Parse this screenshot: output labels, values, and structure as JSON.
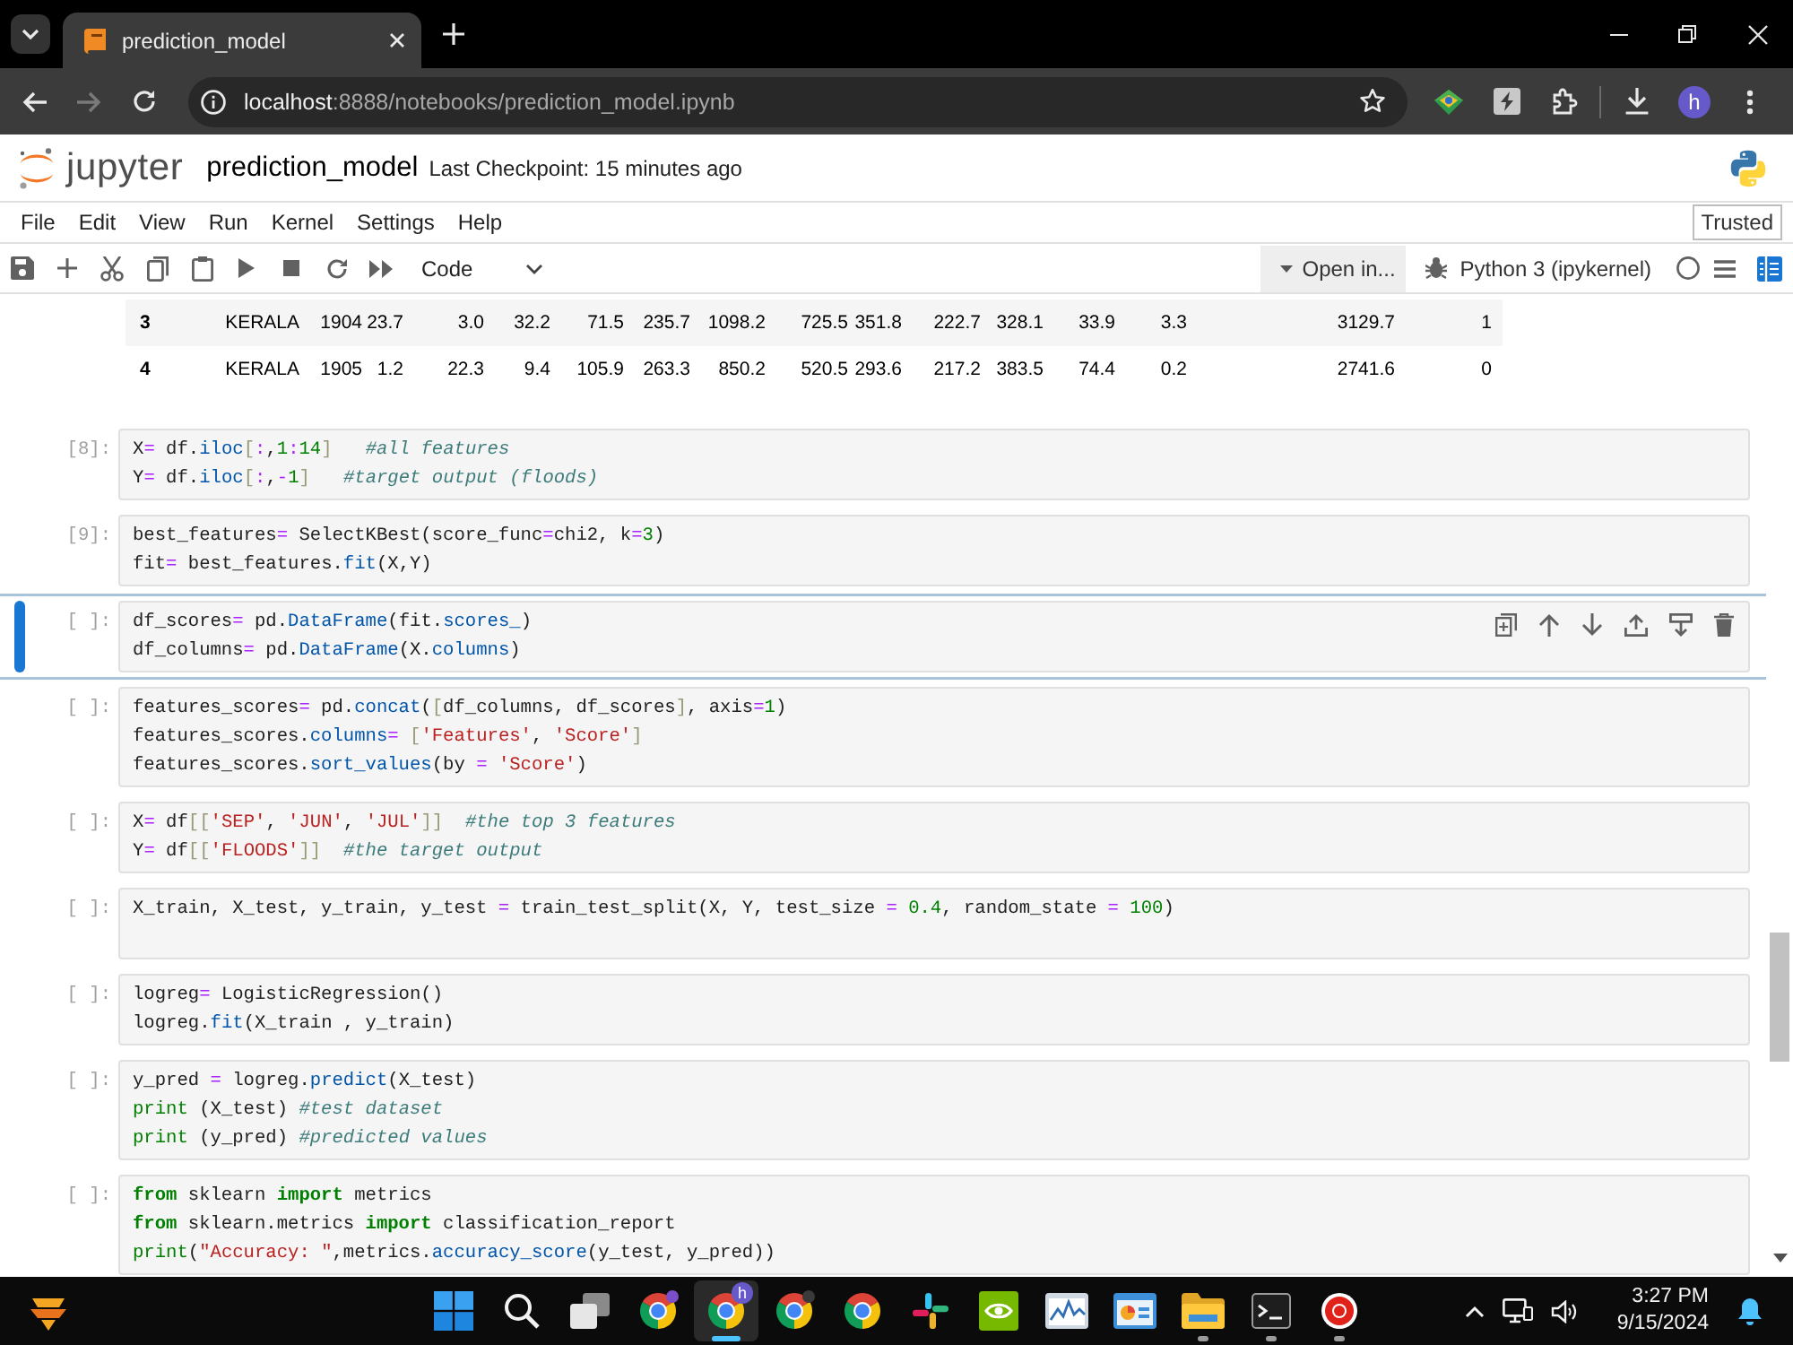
{
  "browser": {
    "tabs": [
      {
        "title": "prediction_model",
        "selected": true
      }
    ],
    "nav": {
      "back_disabled": false,
      "forward_disabled": true
    },
    "address": {
      "host": "localhost",
      "path": ":8888/notebooks/prediction_model.ipynb"
    },
    "profile_initial": "h"
  },
  "notebook_header": {
    "logo_text": "jupyter",
    "title": "prediction_model",
    "checkpoint": "Last Checkpoint: 15 minutes ago"
  },
  "menu": [
    "File",
    "Edit",
    "View",
    "Run",
    "Kernel",
    "Settings",
    "Help"
  ],
  "trust_status": "Trusted",
  "toolbar": {
    "cell_type": "Code",
    "open_in": "Open in...",
    "kernel": "Python 3 (ipykernel)",
    "kernel_busy": false
  },
  "output_table": {
    "rows": [
      [
        "3",
        "KERALA",
        "1904",
        "23.7",
        "3.0",
        "32.2",
        "71.5",
        "235.7",
        "1098.2",
        "725.5",
        "351.8",
        "222.7",
        "328.1",
        "33.9",
        "3.3",
        "3129.7",
        "1"
      ],
      [
        "4",
        "KERALA",
        "1905",
        "1.2",
        "22.3",
        "9.4",
        "105.9",
        "263.3",
        "850.2",
        "520.5",
        "293.6",
        "217.2",
        "383.5",
        "74.4",
        "0.2",
        "2741.6",
        "0"
      ]
    ]
  },
  "cells": [
    {
      "prompt": "[8]:",
      "selected": false,
      "lines": [
        [
          {
            "kind": "plain",
            "text": "X"
          },
          {
            "kind": "op",
            "text": "="
          },
          {
            "kind": "plain",
            "text": " df."
          },
          {
            "kind": "attr",
            "text": "iloc"
          },
          {
            "kind": "bracket",
            "text": "["
          },
          {
            "kind": "op",
            "text": ":"
          },
          {
            "kind": "plain",
            "text": ","
          },
          {
            "kind": "num",
            "text": "1"
          },
          {
            "kind": "op",
            "text": ":"
          },
          {
            "kind": "num",
            "text": "14"
          },
          {
            "kind": "bracket",
            "text": "]   "
          },
          {
            "kind": "comment",
            "text": "#all features"
          }
        ],
        [
          {
            "kind": "plain",
            "text": "Y"
          },
          {
            "kind": "op",
            "text": "="
          },
          {
            "kind": "plain",
            "text": " df."
          },
          {
            "kind": "attr",
            "text": "iloc"
          },
          {
            "kind": "bracket",
            "text": "["
          },
          {
            "kind": "op",
            "text": ":"
          },
          {
            "kind": "plain",
            "text": ","
          },
          {
            "kind": "op",
            "text": "-"
          },
          {
            "kind": "num",
            "text": "1"
          },
          {
            "kind": "bracket",
            "text": "]   "
          },
          {
            "kind": "comment",
            "text": "#target output (floods)"
          }
        ]
      ]
    },
    {
      "prompt": "[9]:",
      "selected": false,
      "lines": [
        [
          {
            "kind": "plain",
            "text": "best_features"
          },
          {
            "kind": "op",
            "text": "="
          },
          {
            "kind": "plain",
            "text": " SelectKBest(score_func"
          },
          {
            "kind": "op",
            "text": "="
          },
          {
            "kind": "plain",
            "text": "chi2, k"
          },
          {
            "kind": "op",
            "text": "="
          },
          {
            "kind": "num",
            "text": "3"
          },
          {
            "kind": "plain",
            "text": ")"
          }
        ],
        [
          {
            "kind": "plain",
            "text": "fit"
          },
          {
            "kind": "op",
            "text": "="
          },
          {
            "kind": "plain",
            "text": " best_features."
          },
          {
            "kind": "attr",
            "text": "fit"
          },
          {
            "kind": "plain",
            "text": "(X,Y)"
          }
        ]
      ]
    },
    {
      "prompt": "[ ]:",
      "selected": true,
      "lines": [
        [
          {
            "kind": "plain",
            "text": "df_scores"
          },
          {
            "kind": "op",
            "text": "="
          },
          {
            "kind": "plain",
            "text": " pd."
          },
          {
            "kind": "attr",
            "text": "DataFrame"
          },
          {
            "kind": "plain",
            "text": "(fit."
          },
          {
            "kind": "attr",
            "text": "scores_"
          },
          {
            "kind": "plain",
            "text": ")"
          }
        ],
        [
          {
            "kind": "plain",
            "text": "df_columns"
          },
          {
            "kind": "op",
            "text": "="
          },
          {
            "kind": "plain",
            "text": " pd."
          },
          {
            "kind": "attr",
            "text": "DataFrame"
          },
          {
            "kind": "plain",
            "text": "(X."
          },
          {
            "kind": "attr",
            "text": "columns"
          },
          {
            "kind": "plain",
            "text": ")"
          }
        ]
      ]
    },
    {
      "prompt": "[ ]:",
      "selected": false,
      "lines": [
        [
          {
            "kind": "plain",
            "text": "features_scores"
          },
          {
            "kind": "op",
            "text": "="
          },
          {
            "kind": "plain",
            "text": " pd."
          },
          {
            "kind": "attr",
            "text": "concat"
          },
          {
            "kind": "plain",
            "text": "("
          },
          {
            "kind": "bracket",
            "text": "["
          },
          {
            "kind": "plain",
            "text": "df_columns, df_scores"
          },
          {
            "kind": "bracket",
            "text": "]"
          },
          {
            "kind": "plain",
            "text": ", axis"
          },
          {
            "kind": "op",
            "text": "="
          },
          {
            "kind": "num",
            "text": "1"
          },
          {
            "kind": "plain",
            "text": ")"
          }
        ],
        [
          {
            "kind": "plain",
            "text": "features_scores."
          },
          {
            "kind": "attr",
            "text": "columns"
          },
          {
            "kind": "op",
            "text": "= "
          },
          {
            "kind": "bracket",
            "text": "["
          },
          {
            "kind": "str",
            "text": "'Features'"
          },
          {
            "kind": "plain",
            "text": ", "
          },
          {
            "kind": "str",
            "text": "'Score'"
          },
          {
            "kind": "bracket",
            "text": "]"
          }
        ],
        [
          {
            "kind": "plain",
            "text": "features_scores."
          },
          {
            "kind": "attr",
            "text": "sort_values"
          },
          {
            "kind": "plain",
            "text": "(by "
          },
          {
            "kind": "op",
            "text": "= "
          },
          {
            "kind": "str",
            "text": "'Score'"
          },
          {
            "kind": "plain",
            "text": ")"
          }
        ]
      ]
    },
    {
      "prompt": "[ ]:",
      "selected": false,
      "lines": [
        [
          {
            "kind": "plain",
            "text": "X"
          },
          {
            "kind": "op",
            "text": "="
          },
          {
            "kind": "plain",
            "text": " df"
          },
          {
            "kind": "bracket",
            "text": "[["
          },
          {
            "kind": "str",
            "text": "'SEP'"
          },
          {
            "kind": "plain",
            "text": ", "
          },
          {
            "kind": "str",
            "text": "'JUN'"
          },
          {
            "kind": "plain",
            "text": ", "
          },
          {
            "kind": "str",
            "text": "'JUL'"
          },
          {
            "kind": "bracket",
            "text": "]]  "
          },
          {
            "kind": "comment",
            "text": "#the top 3 features"
          }
        ],
        [
          {
            "kind": "plain",
            "text": "Y"
          },
          {
            "kind": "op",
            "text": "="
          },
          {
            "kind": "plain",
            "text": " df"
          },
          {
            "kind": "bracket",
            "text": "[["
          },
          {
            "kind": "str",
            "text": "'FLOODS'"
          },
          {
            "kind": "bracket",
            "text": "]]  "
          },
          {
            "kind": "comment",
            "text": "#the target output"
          }
        ]
      ]
    },
    {
      "prompt": "[ ]:",
      "selected": false,
      "lines": [
        [
          {
            "kind": "plain",
            "text": "X_train, X_test, y_train, y_test "
          },
          {
            "kind": "op",
            "text": "="
          },
          {
            "kind": "plain",
            "text": " train_test_split(X, Y, test_size "
          },
          {
            "kind": "op",
            "text": "= "
          },
          {
            "kind": "num",
            "text": "0.4"
          },
          {
            "kind": "plain",
            "text": ", random_state "
          },
          {
            "kind": "op",
            "text": "= "
          },
          {
            "kind": "num",
            "text": "100"
          },
          {
            "kind": "plain",
            "text": ")"
          }
        ]
      ]
    },
    {
      "prompt": "[ ]:",
      "selected": false,
      "lines": [
        [
          {
            "kind": "plain",
            "text": "logreg"
          },
          {
            "kind": "op",
            "text": "="
          },
          {
            "kind": "plain",
            "text": " LogisticRegression()"
          }
        ],
        [
          {
            "kind": "plain",
            "text": "logreg."
          },
          {
            "kind": "attr",
            "text": "fit"
          },
          {
            "kind": "plain",
            "text": "(X_train , y_train)"
          }
        ]
      ]
    },
    {
      "prompt": "[ ]:",
      "selected": false,
      "lines": [
        [
          {
            "kind": "plain",
            "text": "y_pred "
          },
          {
            "kind": "op",
            "text": "="
          },
          {
            "kind": "plain",
            "text": " logreg."
          },
          {
            "kind": "attr",
            "text": "predict"
          },
          {
            "kind": "plain",
            "text": "(X_test)"
          }
        ],
        [
          {
            "kind": "builtin",
            "text": "print"
          },
          {
            "kind": "plain",
            "text": " (X_test) "
          },
          {
            "kind": "comment",
            "text": "#test dataset"
          }
        ],
        [
          {
            "kind": "builtin",
            "text": "print"
          },
          {
            "kind": "plain",
            "text": " (y_pred) "
          },
          {
            "kind": "comment",
            "text": "#predicted values"
          }
        ]
      ]
    },
    {
      "prompt": "[ ]:",
      "selected": false,
      "lines": [
        [
          {
            "kind": "keyword",
            "text": "from"
          },
          {
            "kind": "plain",
            "text": " sklearn "
          },
          {
            "kind": "keyword",
            "text": "import"
          },
          {
            "kind": "plain",
            "text": " metrics"
          }
        ],
        [
          {
            "kind": "keyword",
            "text": "from"
          },
          {
            "kind": "plain",
            "text": " sklearn.metrics "
          },
          {
            "kind": "keyword",
            "text": "import"
          },
          {
            "kind": "plain",
            "text": " classification_report"
          }
        ],
        [
          {
            "kind": "builtin",
            "text": "print"
          },
          {
            "kind": "plain",
            "text": "("
          },
          {
            "kind": "str",
            "text": "\"Accuracy: \""
          },
          {
            "kind": "plain",
            "text": ",metrics."
          },
          {
            "kind": "attr",
            "text": "accuracy_score"
          },
          {
            "kind": "plain",
            "text": "(y_test, y_pred))"
          }
        ]
      ]
    }
  ],
  "taskbar": {
    "apps": [
      {
        "selected": false,
        "open": false
      },
      {
        "selected": false,
        "open": false
      },
      {
        "selected": false,
        "open": false
      },
      {
        "selected": false,
        "open": false
      },
      {
        "selected": true,
        "open": true,
        "badge": "h"
      },
      {
        "selected": false,
        "open": false
      },
      {
        "selected": false,
        "open": false
      },
      {
        "selected": false,
        "open": false
      },
      {
        "selected": false,
        "open": false
      },
      {
        "selected": false,
        "open": false
      },
      {
        "selected": false,
        "open": false
      },
      {
        "selected": false,
        "open": true
      },
      {
        "selected": false,
        "open": true
      },
      {
        "selected": false,
        "open": true
      }
    ],
    "time": "3:27 PM",
    "date": "9/15/2024"
  }
}
